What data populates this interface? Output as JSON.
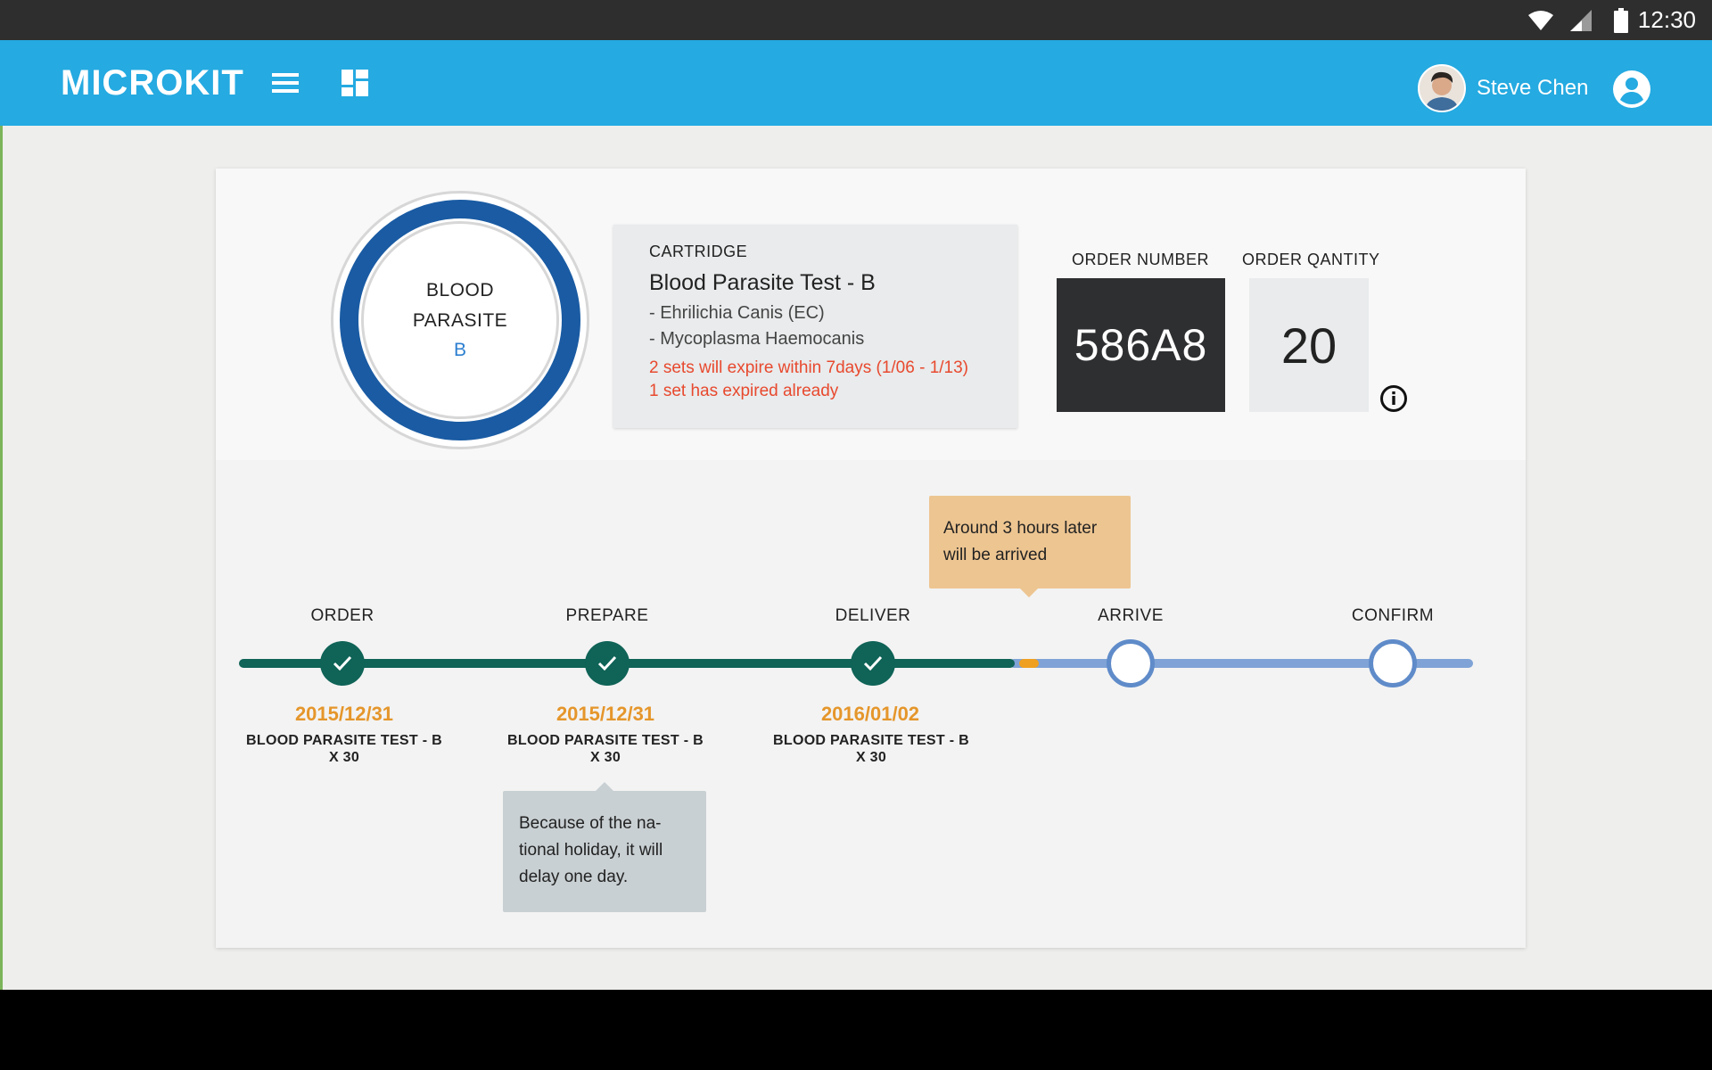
{
  "status_bar": {
    "time": "12:30",
    "icons": [
      "wifi-icon",
      "cellular-signal-icon",
      "battery-icon"
    ]
  },
  "app_bar": {
    "brand": "MICROKIT",
    "icons": [
      "menu-icon",
      "dashboard-icon",
      "account-circle-icon"
    ],
    "user_name": "Steve Chen"
  },
  "product": {
    "ring_line1": "BLOOD",
    "ring_line2": "PARASITE",
    "ring_letter": "B"
  },
  "cartridge": {
    "label": "CARTRIDGE",
    "title": "Blood Parasite Test - B",
    "items": [
      "- Ehrilichia Canis (EC)",
      "- Mycoplasma Haemocanis"
    ],
    "warnings": [
      "2 sets will expire within 7days (1/06 - 1/13)",
      "1 set has expired already"
    ]
  },
  "order": {
    "number_label": "ORDER NUMBER",
    "number": "586A8",
    "quantity_label": "ORDER QANTITY",
    "quantity": "20"
  },
  "timeline": {
    "eta_tooltip": "Around 3 hours later will be arrived",
    "note_tooltip": "Because of the na-tional holiday, it will delay one day.",
    "steps": [
      {
        "label": "ORDER",
        "date": "2015/12/31",
        "desc_line1": "BLOOD PARASITE TEST - B",
        "desc_line2": "X 30",
        "done": true
      },
      {
        "label": "PREPARE",
        "date": "2015/12/31",
        "desc_line1": "BLOOD PARASITE TEST - B",
        "desc_line2": "X 30",
        "done": true
      },
      {
        "label": "DELIVER",
        "date": "2016/01/02",
        "desc_line1": "BLOOD PARASITE TEST - B",
        "desc_line2": "X 30",
        "done": true
      },
      {
        "label": "ARRIVE",
        "done": false
      },
      {
        "label": "CONFIRM",
        "done": false
      }
    ]
  },
  "colors": {
    "app_bar": "#25aae1",
    "done": "#0f6357",
    "todo": "#7fa3d6",
    "date": "#e5962b",
    "warning": "#e8492e",
    "ring": "#1a5ba3"
  }
}
